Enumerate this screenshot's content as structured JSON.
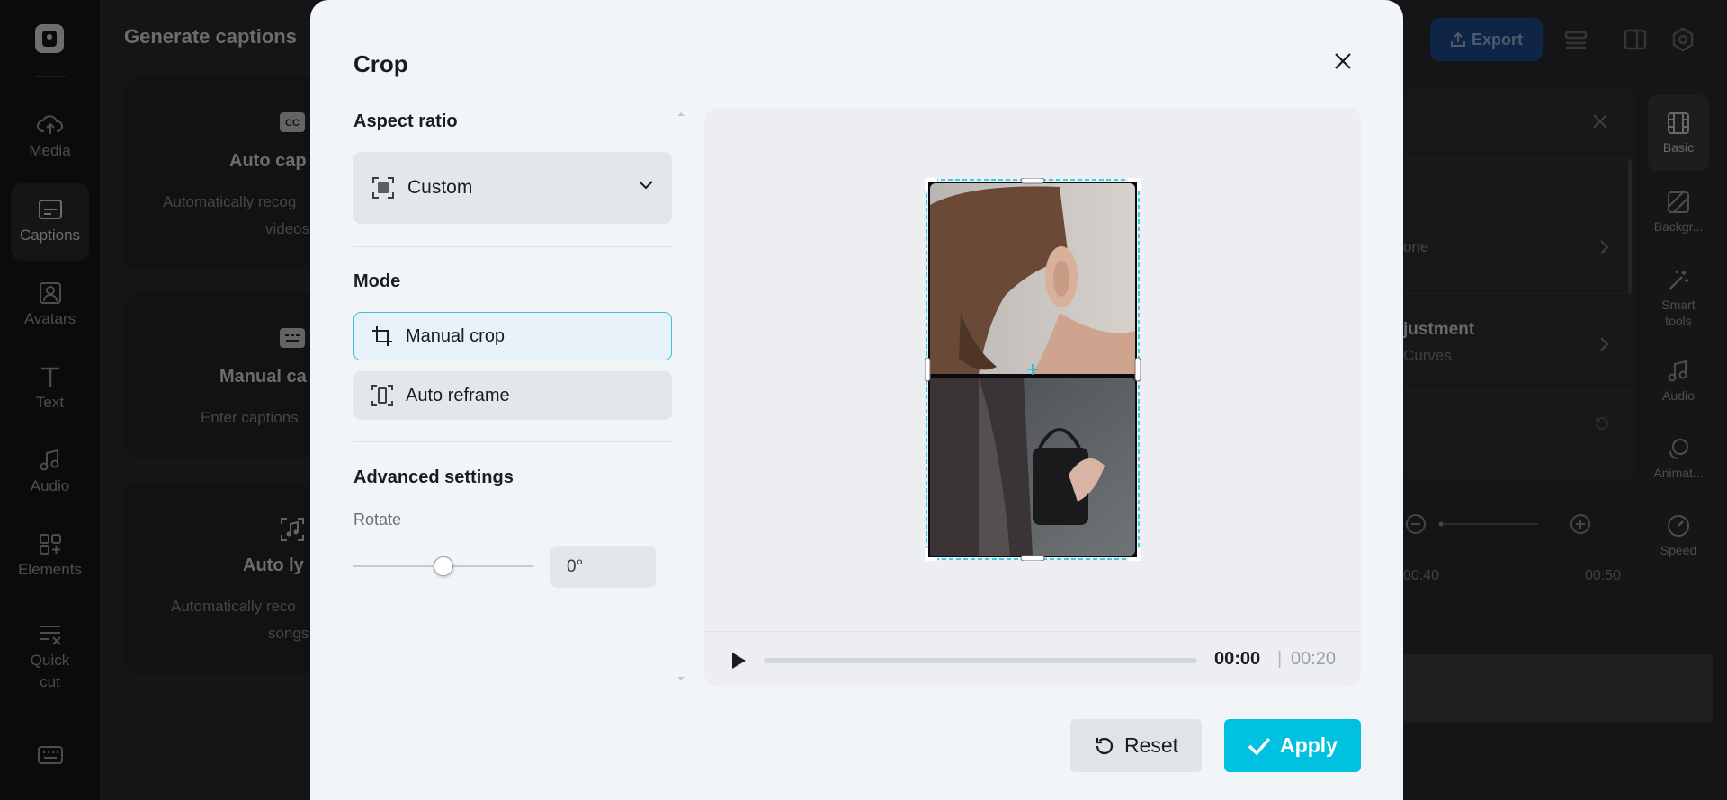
{
  "rail": {
    "items": [
      {
        "label": "Media",
        "icon": "cloud-upload-icon"
      },
      {
        "label": "Captions",
        "icon": "captions-icon",
        "active": true
      },
      {
        "label": "Avatars",
        "icon": "avatar-icon"
      },
      {
        "label": "Text",
        "icon": "text-icon"
      },
      {
        "label": "Audio",
        "icon": "music-note-icon"
      },
      {
        "label": "Elements",
        "icon": "elements-icon"
      },
      {
        "label": "Quick cut",
        "icon": "quick-cut-icon"
      }
    ]
  },
  "captions_panel": {
    "title": "Generate captions",
    "cards": [
      {
        "title": "Auto cap",
        "desc": [
          "Automatically recog",
          "videos"
        ]
      },
      {
        "title": "Manual ca",
        "desc": [
          "Enter captions"
        ]
      },
      {
        "title": "Auto ly",
        "desc": [
          "Automatically reco",
          "songs"
        ]
      }
    ]
  },
  "header": {
    "export_label": "Export"
  },
  "properties_panel": {
    "row1_sub": "one",
    "row2_title": "justment",
    "row2_sub": "Curves"
  },
  "right_rail": {
    "items": [
      {
        "label": "Basic",
        "icon": "film-icon",
        "active": true
      },
      {
        "label": "Backgr...",
        "icon": "background-icon"
      },
      {
        "label": "Smart tools",
        "icon": "magic-wand-icon"
      },
      {
        "label": "Audio",
        "icon": "music-note-icon"
      },
      {
        "label": "Animat...",
        "icon": "animation-icon"
      },
      {
        "label": "Speed",
        "icon": "speed-icon"
      }
    ]
  },
  "timeline": {
    "marks": [
      "00:40",
      "00:50"
    ]
  },
  "crop_modal": {
    "title": "Crop",
    "aspect_ratio": {
      "heading": "Aspect ratio",
      "selected": "Custom"
    },
    "mode": {
      "heading": "Mode",
      "options": [
        {
          "label": "Manual crop",
          "selected": true
        },
        {
          "label": "Auto reframe",
          "selected": false
        }
      ]
    },
    "advanced": {
      "heading": "Advanced settings",
      "rotate_label": "Rotate",
      "rotate_value": "0°",
      "rotate_level": 0.5
    },
    "player": {
      "current_time": "00:00",
      "separator": "|",
      "total_time": "00:20",
      "progress": 0
    },
    "reset_label": "Reset",
    "apply_label": "Apply"
  },
  "colors": {
    "accent": "#00c2e0",
    "selected_border": "#3bc3d9",
    "export_bg": "#1e4a8a"
  }
}
